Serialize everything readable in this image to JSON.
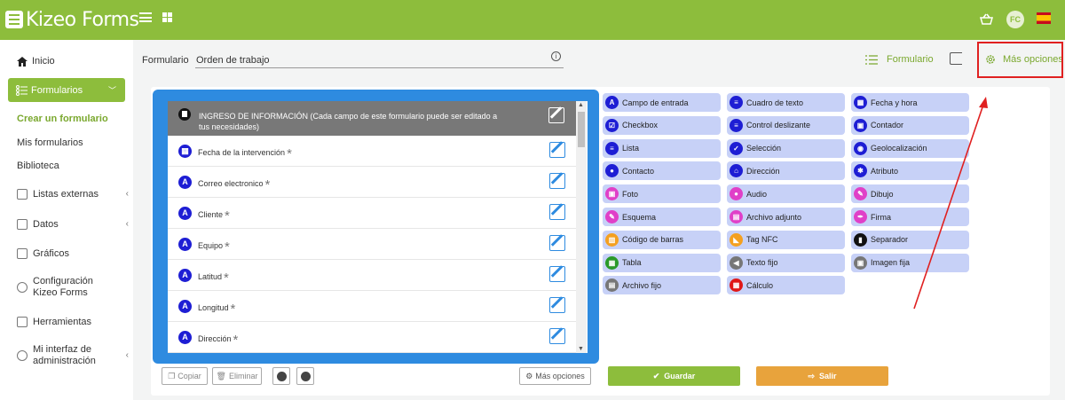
{
  "app": {
    "logo_text": "Kizeo Forms",
    "avatar_initials": "FC"
  },
  "colors": {
    "brand": "#8dbd3c",
    "accent_blue": "#2e8be0",
    "field_icon": "#1e1ed4",
    "save": "#8dbd3c",
    "exit": "#e8a33c",
    "highlight": "#e02020"
  },
  "sidebar": {
    "home": "Inicio",
    "forms": "Formularios",
    "sub": [
      "Crear un formulario",
      "Mis formularios",
      "Biblioteca"
    ],
    "items": [
      {
        "label": "Listas externas"
      },
      {
        "label": "Datos"
      },
      {
        "label": "Gráficos"
      },
      {
        "label1": "Configuración",
        "label2": "Kizeo Forms"
      },
      {
        "label": "Herramientas"
      },
      {
        "label1": "Mi interfaz de",
        "label2": "administración"
      }
    ]
  },
  "header": {
    "form_label": "Formulario",
    "form_name": "Orden de trabajo",
    "tab_formulario": "Formulario",
    "tab_mas_opciones": "Más opciones"
  },
  "form_fields": {
    "separator": "INGRESO DE INFORMACIÓN (Cada campo de este formulario puede ser editado a tus necesidades)",
    "fields": [
      {
        "label": "Fecha de la intervención",
        "icon": "calendar-icon",
        "required": "*"
      },
      {
        "label": "Correo electronico",
        "icon": "text-field-icon",
        "required": "*"
      },
      {
        "label": "Cliente",
        "icon": "text-field-icon",
        "required": "*"
      },
      {
        "label": "Equipo",
        "icon": "text-field-icon",
        "required": "*"
      },
      {
        "label": "Latitud",
        "icon": "text-field-icon",
        "required": "*"
      },
      {
        "label": "Longitud",
        "icon": "text-field-icon",
        "required": "*"
      },
      {
        "label": "Dirección",
        "icon": "text-field-icon",
        "required": "*"
      }
    ]
  },
  "palette": [
    {
      "label": "Campo de entrada",
      "color": "#1e1ed4",
      "glyph": "A"
    },
    {
      "label": "Cuadro de texto",
      "color": "#1e1ed4",
      "glyph": "≡"
    },
    {
      "label": "Fecha y hora",
      "color": "#1e1ed4",
      "glyph": "▦"
    },
    {
      "label": "Checkbox",
      "color": "#1e1ed4",
      "glyph": "☑"
    },
    {
      "label": "Control deslizante",
      "color": "#1e1ed4",
      "glyph": "≡"
    },
    {
      "label": "Contador",
      "color": "#1e1ed4",
      "glyph": "▣"
    },
    {
      "label": "Lista",
      "color": "#1e1ed4",
      "glyph": "≡"
    },
    {
      "label": "Selección",
      "color": "#1e1ed4",
      "glyph": "✓"
    },
    {
      "label": "Geolocalización",
      "color": "#1e1ed4",
      "glyph": "◉"
    },
    {
      "label": "Contacto",
      "color": "#1e1ed4",
      "glyph": "●"
    },
    {
      "label": "Dirección",
      "color": "#1e1ed4",
      "glyph": "⌂"
    },
    {
      "label": "Atributo",
      "color": "#1e1ed4",
      "glyph": "✱"
    },
    {
      "label": "Foto",
      "color": "#e040c8",
      "glyph": "▣"
    },
    {
      "label": "Audio",
      "color": "#e040c8",
      "glyph": "●"
    },
    {
      "label": "Dibujo",
      "color": "#e040c8",
      "glyph": "✎"
    },
    {
      "label": "Esquema",
      "color": "#e040c8",
      "glyph": "✎"
    },
    {
      "label": "Archivo adjunto",
      "color": "#e040c8",
      "glyph": "▤"
    },
    {
      "label": "Firma",
      "color": "#e040c8",
      "glyph": "✒"
    },
    {
      "label": "Código de barras",
      "color": "#f4a020",
      "glyph": "▥"
    },
    {
      "label": "Tag NFC",
      "color": "#f4a020",
      "glyph": "◣"
    },
    {
      "label": "Separador",
      "color": "#111111",
      "glyph": "▮"
    },
    {
      "label": "Tabla",
      "color": "#2a9a2a",
      "glyph": "▦"
    },
    {
      "label": "Texto fijo",
      "color": "#777777",
      "glyph": "◀"
    },
    {
      "label": "Imagen fija",
      "color": "#777777",
      "glyph": "▣"
    },
    {
      "label": "Archivo fijo",
      "color": "#777777",
      "glyph": "▤"
    },
    {
      "label": "Cálculo",
      "color": "#e01818",
      "glyph": "▦"
    }
  ],
  "buttons": {
    "copy": "Copiar",
    "delete": "Eliminar",
    "more_options": "Más opciones",
    "save": "Guardar",
    "exit": "Salir"
  }
}
